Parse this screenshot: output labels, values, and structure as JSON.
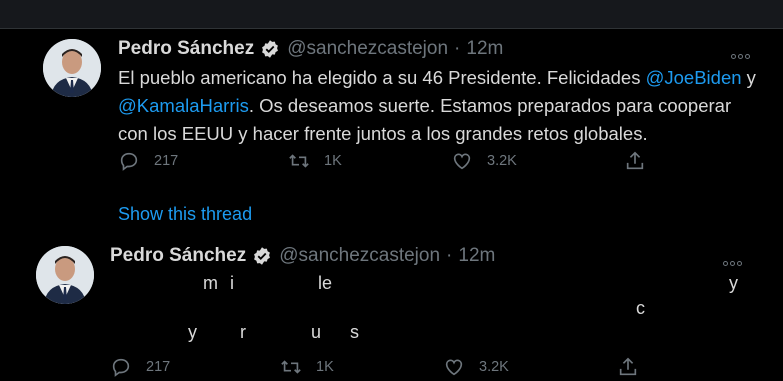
{
  "tweets": [
    {
      "author": "Pedro Sánchez",
      "handle": "@sanchezcastejon",
      "separator": "·",
      "time": "12m",
      "text_before": "El pueblo americano ha elegido a su 46 Presidente. Felicidades ",
      "mention1": "@JoeBiden",
      "text_mid": " y",
      "mention2": "@KamalaHarris",
      "text_after": ". Os deseamos suerte. Estamos preparados para cooperar con los EEUU y hacer frente juntos a los grandes retos globales.",
      "replies": "217",
      "retweets": "1K",
      "likes": "3.2K"
    },
    {
      "author": "Pedro Sánchez",
      "handle": "@sanchezcastejon",
      "separator": "·",
      "time": "12m",
      "fragments": [
        "m",
        "i",
        "le",
        "y",
        "c",
        "y",
        "r",
        "u",
        "s"
      ],
      "replies": "217",
      "retweets": "1K",
      "likes": "3.2K"
    }
  ],
  "show_thread": "Show this thread",
  "icons": {
    "verified": "verified-badge-icon",
    "more": "more-options-icon",
    "reply": "reply-icon",
    "retweet": "retweet-icon",
    "like": "heart-icon",
    "share": "share-icon"
  },
  "colors": {
    "background": "#000000",
    "accent": "#1d9bf0",
    "muted": "#6e767d",
    "text": "#d9d9d9"
  }
}
